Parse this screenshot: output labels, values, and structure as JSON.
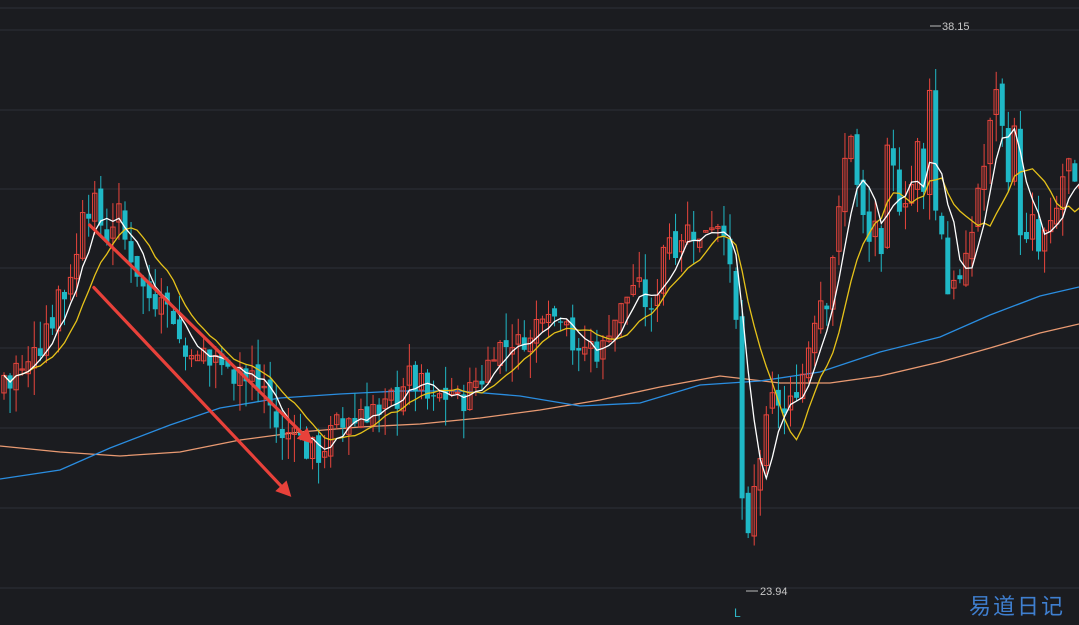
{
  "chart_data": {
    "type": "candlestick",
    "high_label": "38.15",
    "low_label": "23.94",
    "period_marker": "L",
    "watermark": "易道日记",
    "grid": true,
    "colors": {
      "up": "#e8453c",
      "down": "#1fb8c6",
      "ma5": "#ffffff",
      "ma10": "#e6c21a",
      "ma60": "#2a8de0",
      "ma120": "#e99a72",
      "arrow": "#e8413a"
    },
    "candles_anchor": [
      [
        0,
        28.9
      ],
      [
        6,
        29.6
      ],
      [
        12,
        28.8
      ],
      [
        18,
        30.0
      ],
      [
        24,
        29.2
      ],
      [
        30,
        29.8
      ],
      [
        36,
        30.4
      ],
      [
        42,
        29.9
      ],
      [
        48,
        31.0
      ],
      [
        54,
        30.6
      ],
      [
        60,
        31.8
      ],
      [
        66,
        31.2
      ],
      [
        72,
        32.2
      ],
      [
        78,
        32.4
      ],
      [
        84,
        34.0
      ],
      [
        90,
        33.4
      ],
      [
        96,
        33.8
      ],
      [
        102,
        33.0
      ],
      [
        108,
        32.8
      ],
      [
        114,
        33.3
      ],
      [
        120,
        33.5
      ],
      [
        126,
        32.6
      ],
      [
        132,
        32.3
      ],
      [
        138,
        31.9
      ],
      [
        144,
        31.5
      ],
      [
        150,
        31.3
      ],
      [
        156,
        31.2
      ],
      [
        162,
        31.6
      ],
      [
        168,
        31.0
      ],
      [
        174,
        30.8
      ],
      [
        180,
        30.2
      ],
      [
        186,
        29.8
      ],
      [
        192,
        30.1
      ],
      [
        198,
        29.7
      ],
      [
        204,
        30.0
      ],
      [
        210,
        29.6
      ],
      [
        216,
        29.9
      ],
      [
        222,
        29.5
      ],
      [
        228,
        29.8
      ],
      [
        234,
        29.3
      ],
      [
        240,
        29.6
      ],
      [
        246,
        29.2
      ],
      [
        252,
        29.4
      ],
      [
        258,
        29.0
      ],
      [
        264,
        29.1
      ],
      [
        270,
        28.6
      ],
      [
        276,
        28.1
      ],
      [
        282,
        27.7
      ],
      [
        288,
        27.9
      ],
      [
        294,
        28.3
      ],
      [
        300,
        27.8
      ],
      [
        306,
        27.4
      ],
      [
        312,
        27.6
      ],
      [
        318,
        27.3
      ],
      [
        324,
        27.5
      ],
      [
        330,
        27.9
      ],
      [
        336,
        28.2
      ],
      [
        342,
        28.0
      ],
      [
        348,
        28.4
      ],
      [
        354,
        28.1
      ],
      [
        360,
        28.6
      ],
      [
        366,
        28.3
      ],
      [
        372,
        28.7
      ],
      [
        378,
        28.2
      ],
      [
        384,
        28.5
      ],
      [
        390,
        28.9
      ],
      [
        396,
        28.6
      ],
      [
        402,
        29.1
      ],
      [
        408,
        29.5
      ],
      [
        414,
        29.0
      ],
      [
        420,
        29.3
      ],
      [
        426,
        28.8
      ],
      [
        432,
        28.6
      ],
      [
        438,
        28.9
      ],
      [
        444,
        28.7
      ],
      [
        450,
        29.1
      ],
      [
        456,
        28.8
      ],
      [
        462,
        28.6
      ],
      [
        468,
        28.9
      ],
      [
        474,
        29.3
      ],
      [
        480,
        29.1
      ],
      [
        486,
        29.6
      ],
      [
        492,
        29.9
      ],
      [
        498,
        30.2
      ],
      [
        504,
        30.0
      ],
      [
        510,
        30.3
      ],
      [
        516,
        30.1
      ],
      [
        522,
        30.4
      ],
      [
        528,
        30.0
      ],
      [
        534,
        30.6
      ],
      [
        540,
        30.9
      ],
      [
        546,
        31.2
      ],
      [
        552,
        31.0
      ],
      [
        558,
        30.6
      ],
      [
        564,
        31.3
      ],
      [
        570,
        30.4
      ],
      [
        576,
        29.7
      ],
      [
        582,
        29.9
      ],
      [
        588,
        30.3
      ],
      [
        594,
        30.0
      ],
      [
        600,
        29.8
      ],
      [
        606,
        30.4
      ],
      [
        612,
        30.7
      ],
      [
        618,
        30.9
      ],
      [
        624,
        31.2
      ],
      [
        630,
        31.5
      ],
      [
        636,
        31.8
      ],
      [
        642,
        31.4
      ],
      [
        648,
        31.0
      ],
      [
        654,
        30.7
      ],
      [
        660,
        32.2
      ],
      [
        666,
        33.0
      ],
      [
        672,
        32.8
      ],
      [
        678,
        32.4
      ],
      [
        684,
        33.2
      ],
      [
        690,
        33.0
      ],
      [
        696,
        32.9
      ],
      [
        702,
        32.6
      ],
      [
        708,
        33.4
      ],
      [
        714,
        33.1
      ],
      [
        720,
        33.3
      ],
      [
        726,
        33.0
      ],
      [
        732,
        31.4
      ],
      [
        738,
        30.3
      ],
      [
        744,
        24.4
      ],
      [
        750,
        25.5
      ],
      [
        756,
        26.9
      ],
      [
        762,
        27.5
      ],
      [
        768,
        28.4
      ],
      [
        774,
        28.9
      ],
      [
        780,
        28.6
      ],
      [
        786,
        28.3
      ],
      [
        792,
        28.8
      ],
      [
        798,
        29.1
      ],
      [
        804,
        29.5
      ],
      [
        810,
        30.3
      ],
      [
        816,
        31.0
      ],
      [
        822,
        31.4
      ],
      [
        828,
        31.2
      ],
      [
        834,
        32.7
      ],
      [
        840,
        33.6
      ],
      [
        846,
        35.0
      ],
      [
        852,
        35.6
      ],
      [
        858,
        33.8
      ],
      [
        864,
        33.2
      ],
      [
        870,
        32.6
      ],
      [
        876,
        33.4
      ],
      [
        882,
        32.0
      ],
      [
        888,
        35.3
      ],
      [
        894,
        34.4
      ],
      [
        900,
        33.6
      ],
      [
        906,
        33.9
      ],
      [
        912,
        34.2
      ],
      [
        918,
        35.2
      ],
      [
        924,
        33.8
      ],
      [
        930,
        36.9
      ],
      [
        936,
        33.3
      ],
      [
        942,
        33.0
      ],
      [
        948,
        31.4
      ],
      [
        954,
        31.9
      ],
      [
        960,
        31.7
      ],
      [
        966,
        32.2
      ],
      [
        972,
        33.0
      ],
      [
        978,
        34.1
      ],
      [
        984,
        34.6
      ],
      [
        990,
        35.6
      ],
      [
        996,
        36.7
      ],
      [
        1002,
        35.6
      ],
      [
        1008,
        34.4
      ],
      [
        1014,
        35.6
      ],
      [
        1020,
        33.1
      ],
      [
        1026,
        32.6
      ],
      [
        1032,
        33.3
      ],
      [
        1038,
        32.4
      ],
      [
        1044,
        32.9
      ],
      [
        1050,
        33.0
      ],
      [
        1056,
        33.4
      ],
      [
        1062,
        34.3
      ],
      [
        1068,
        34.8
      ],
      [
        1074,
        34.0
      ]
    ],
    "trend_lines": [
      {
        "from": [
          0.083,
          0.36
        ],
        "to": [
          0.29,
          0.71
        ]
      },
      {
        "from": [
          0.087,
          0.46
        ],
        "to": [
          0.27,
          0.795
        ]
      }
    ]
  }
}
